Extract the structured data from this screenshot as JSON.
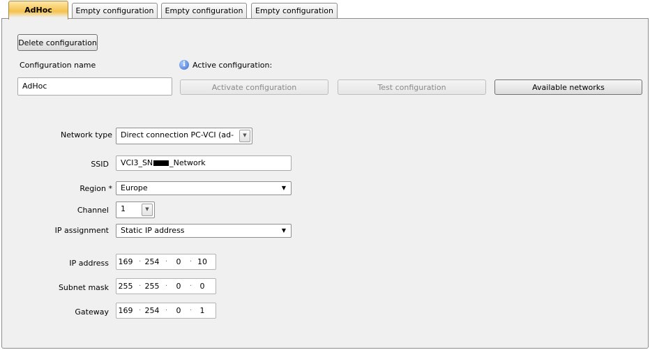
{
  "tabs": [
    {
      "label": "AdHoc",
      "active": true
    },
    {
      "label": "Empty configuration",
      "active": false
    },
    {
      "label": "Empty configuration",
      "active": false
    },
    {
      "label": "Empty configuration",
      "active": false
    }
  ],
  "actions": {
    "delete_label": "Delete configuration",
    "activate_label": "Activate configuration",
    "test_label": "Test configuration",
    "networks_label": "Available networks"
  },
  "config": {
    "name_label": "Configuration name",
    "name_value": "AdHoc",
    "active_label": "Active configuration:"
  },
  "form": {
    "network_type_label": "Network type",
    "network_type_value": "Direct connection PC-VCI (ad-",
    "ssid_label": "SSID",
    "ssid_prefix": "VCI3_SN",
    "ssid_suffix": "_Network",
    "region_label": "Region *",
    "region_value": "Europe",
    "channel_label": "Channel",
    "channel_value": "1",
    "ip_assignment_label": "IP assignment",
    "ip_assignment_value": "Static IP address",
    "ip_address_label": "IP address",
    "ip_address": [
      "169",
      "254",
      "0",
      "10"
    ],
    "subnet_label": "Subnet mask",
    "subnet": [
      "255",
      "255",
      "0",
      "0"
    ],
    "gateway_label": "Gateway",
    "gateway": [
      "169",
      "254",
      "0",
      "1"
    ]
  },
  "icons": {
    "info": "info-icon",
    "dropdown": "chevron-down-icon"
  },
  "colors": {
    "active_tab": "#f4c24c",
    "panel_bg": "#f0f0f0",
    "info_icon": "#3b6fd1"
  }
}
